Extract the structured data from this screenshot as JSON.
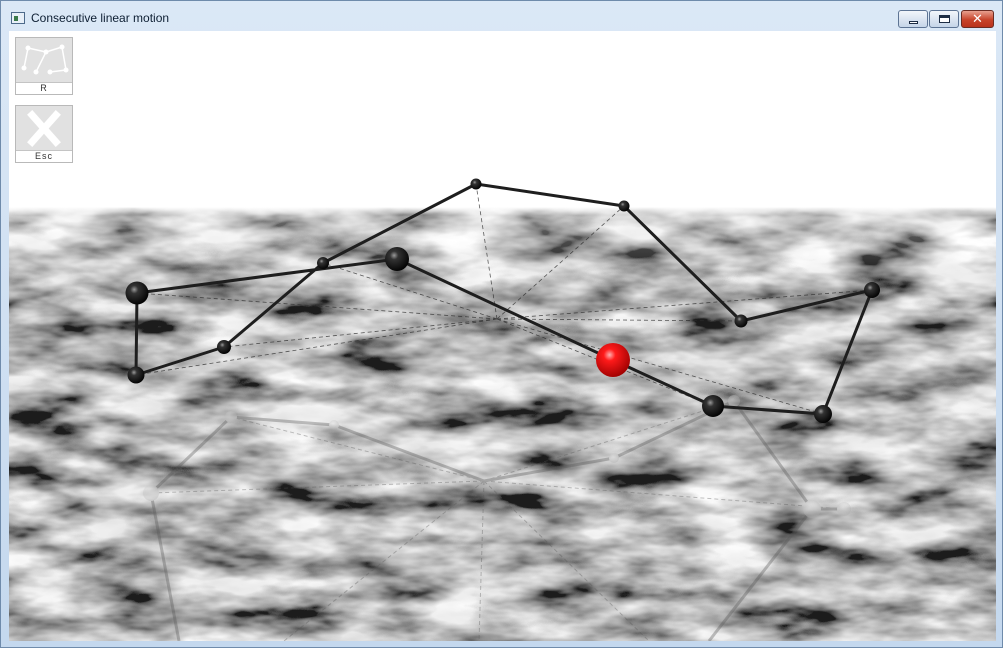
{
  "window": {
    "title": "Consecutive linear motion",
    "minimize_glyph": "minimize-icon",
    "maximize_glyph": "maximize-icon",
    "close_glyph": "✕"
  },
  "hud": {
    "reset_label": "R",
    "escape_label": "Esc",
    "reset_icon": "graph-nodes-icon",
    "escape_icon": "close-x-icon"
  },
  "scene": {
    "path_color": "#1e1e1e",
    "moving_ball_color": "#e00000",
    "node_color": "#111111",
    "floor": "marble"
  }
}
